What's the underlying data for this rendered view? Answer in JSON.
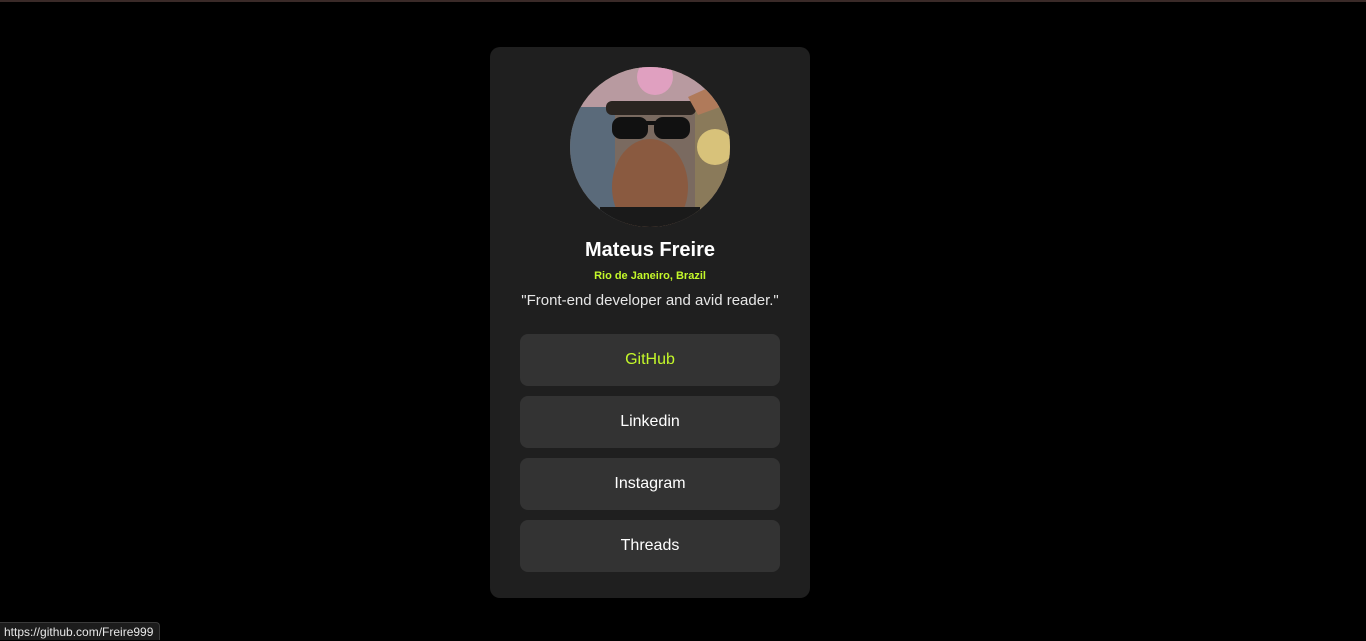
{
  "profile": {
    "name": "Mateus Freire",
    "location": "Rio de Janeiro, Brazil",
    "bio": "\"Front-end developer and avid reader.\""
  },
  "links": [
    {
      "label": "GitHub",
      "active": true
    },
    {
      "label": "Linkedin",
      "active": false
    },
    {
      "label": "Instagram",
      "active": false
    },
    {
      "label": "Threads",
      "active": false
    }
  ],
  "status_bar": {
    "url": "https://github.com/Freire999"
  },
  "colors": {
    "background": "#000000",
    "card": "#1f1f1f",
    "button": "#333333",
    "accent": "#c4f82a",
    "text": "#ffffff"
  },
  "icons": {
    "avatar": "profile-photo"
  }
}
